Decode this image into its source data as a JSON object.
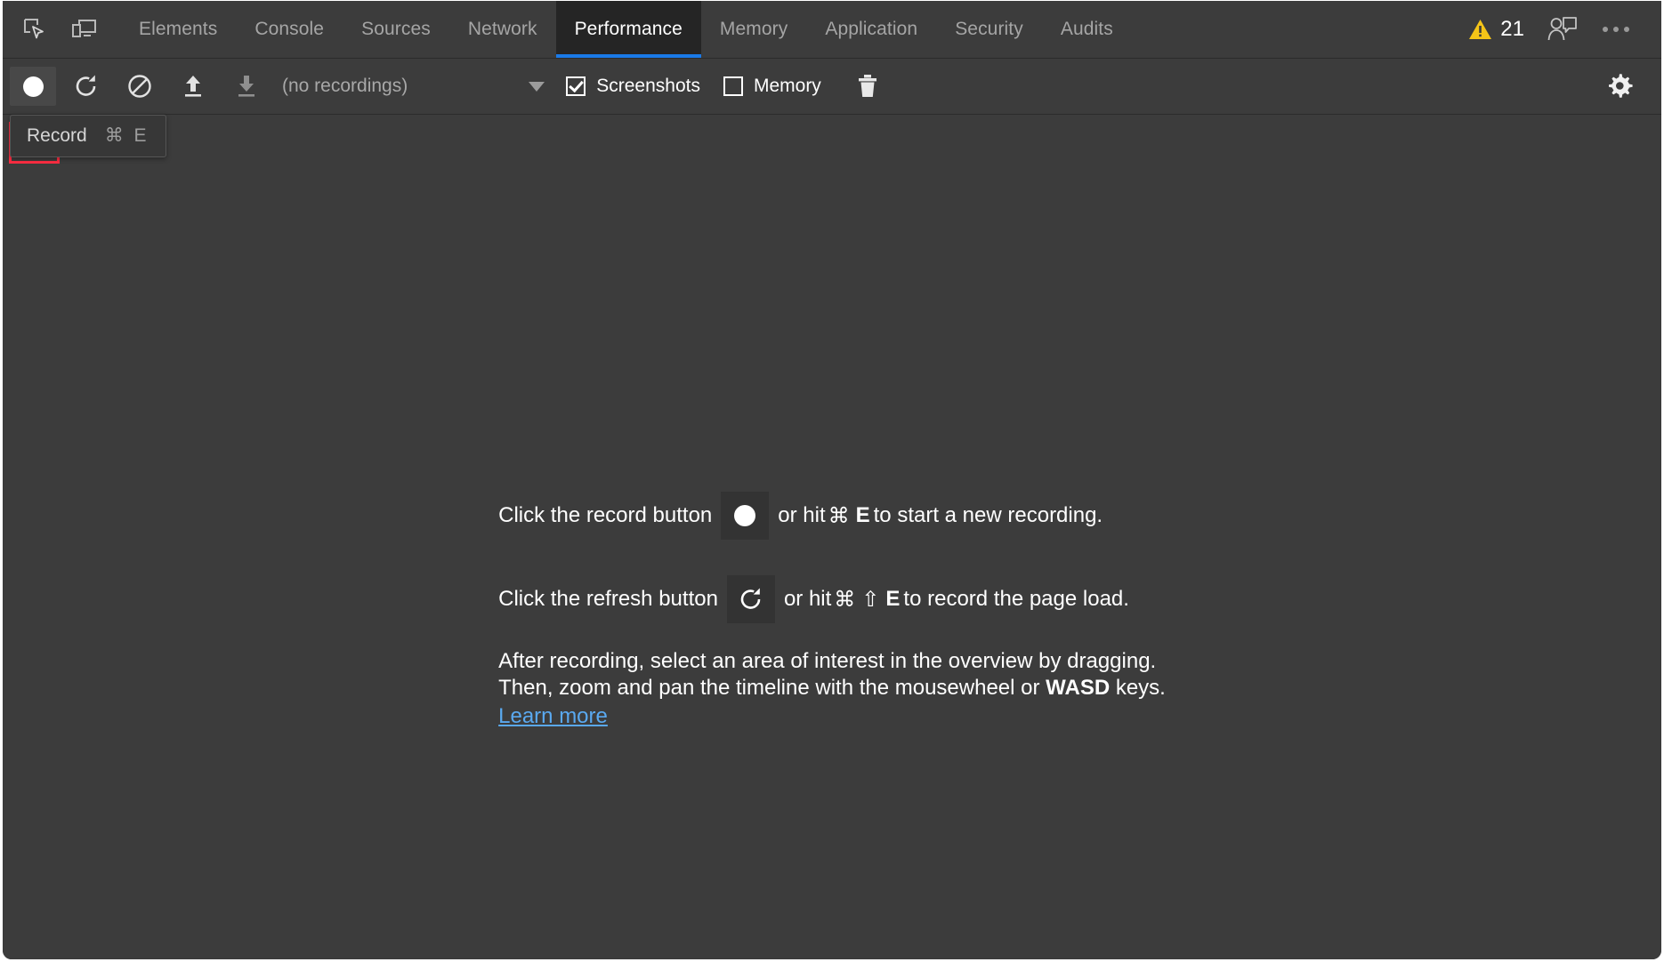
{
  "tabbar": {
    "inspect_icon": "inspect-element-icon",
    "device_icon": "device-toolbar-icon",
    "tabs": [
      {
        "label": "Elements",
        "active": false
      },
      {
        "label": "Console",
        "active": false
      },
      {
        "label": "Sources",
        "active": false
      },
      {
        "label": "Network",
        "active": false
      },
      {
        "label": "Performance",
        "active": true
      },
      {
        "label": "Memory",
        "active": false
      },
      {
        "label": "Application",
        "active": false
      },
      {
        "label": "Security",
        "active": false
      },
      {
        "label": "Audits",
        "active": false
      }
    ],
    "warning_count": "21",
    "warning_icon": "warning-triangle-icon",
    "feedback_icon": "feedback-person-icon",
    "more_icon": "more-options-icon",
    "active_tab_accent": "#1a7ae8",
    "warning_color": "#f5c518"
  },
  "toolbar": {
    "record_icon": "record-circle-icon",
    "reload_icon": "reload-record-icon",
    "clear_icon": "clear-recording-icon",
    "load_icon": "load-profile-icon",
    "save_icon": "save-profile-icon",
    "recordings_label": "(no recordings)",
    "dropdown_icon": "chevron-down-icon",
    "screenshots_label": "Screenshots",
    "screenshots_checked": true,
    "memory_label": "Memory",
    "memory_checked": false,
    "trash_icon": "trash-icon",
    "settings_icon": "gear-icon",
    "record_highlight_color": "#ff2d42"
  },
  "tooltip": {
    "label": "Record",
    "shortcut": "⌘ E"
  },
  "landing": {
    "line1": {
      "prefix": "Click the record button",
      "icon": "record-circle-icon",
      "mid": "or hit",
      "key_cmd": "⌘",
      "key_letter": "E",
      "suffix": "to start a new recording."
    },
    "line2": {
      "prefix": "Click the refresh button",
      "icon": "reload-record-icon",
      "mid": "or hit",
      "key_cmd": "⌘",
      "key_shift": "⇧",
      "key_letter": "E",
      "suffix": "to record the page load."
    },
    "para_line1": "After recording, select an area of interest in the overview by dragging.",
    "para_line2_a": "Then, zoom and pan the timeline with the mousewheel or",
    "para_line2_b": "WASD",
    "para_line2_c": "keys.",
    "learn_more": "Learn more",
    "link_color": "#5aa9f0"
  }
}
